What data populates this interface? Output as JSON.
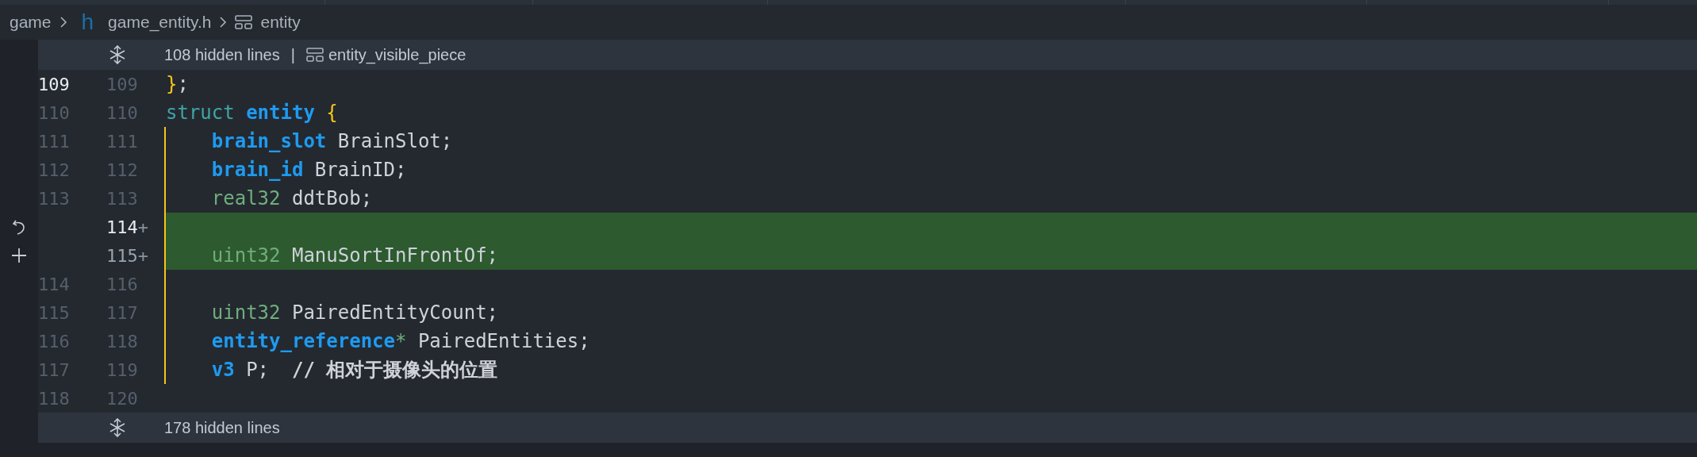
{
  "breadcrumb": {
    "items": [
      {
        "kind": "folder",
        "label": "game"
      },
      {
        "kind": "file",
        "icon_text": "h",
        "label": "game_entity.h"
      },
      {
        "kind": "symbol",
        "label": "entity"
      }
    ]
  },
  "folds": [
    {
      "label": "108 hidden lines",
      "separator": "|",
      "symbol": "entity_visible_piece"
    },
    {
      "label": "178 hidden lines"
    }
  ],
  "lines": [
    {
      "kind": "unchanged",
      "old": "109",
      "new": "109",
      "current": true,
      "guide": false,
      "tokens": [
        {
          "kind": "brace",
          "text": "}"
        },
        {
          "kind": "plain",
          "text": ";"
        }
      ]
    },
    {
      "kind": "unchanged",
      "old": "110",
      "new": "110",
      "current": false,
      "guide": false,
      "tokens": [
        {
          "kind": "keyword",
          "text": "struct "
        },
        {
          "kind": "type_bold",
          "text": "entity"
        },
        {
          "kind": "brace",
          "text": " {"
        }
      ]
    },
    {
      "kind": "unchanged",
      "old": "111",
      "new": "111",
      "current": false,
      "guide": true,
      "tokens": [
        {
          "kind": "type_bold",
          "text": "    brain_slot"
        },
        {
          "kind": "plain",
          "text": " BrainSlot;"
        }
      ]
    },
    {
      "kind": "unchanged",
      "old": "112",
      "new": "112",
      "current": false,
      "guide": true,
      "tokens": [
        {
          "kind": "type_bold",
          "text": "    brain_id"
        },
        {
          "kind": "plain",
          "text": " BrainID;"
        }
      ]
    },
    {
      "kind": "unchanged",
      "old": "113",
      "new": "113",
      "current": false,
      "guide": true,
      "tokens": [
        {
          "kind": "type",
          "text": "    real32"
        },
        {
          "kind": "plain",
          "text": " ddtBob;"
        }
      ]
    },
    {
      "kind": "added_revert",
      "new": "114",
      "current": true,
      "guide": true,
      "marker": "+"
    },
    {
      "kind": "added_stage",
      "new": "115",
      "current": false,
      "guide": true,
      "marker": "+",
      "tokens": [
        {
          "kind": "type",
          "text": "    uint32"
        },
        {
          "kind": "plain",
          "text": " ManuSortInFrontOf;"
        }
      ]
    },
    {
      "kind": "unchanged",
      "old": "114",
      "new": "116",
      "current": false,
      "guide": true
    },
    {
      "kind": "unchanged",
      "old": "115",
      "new": "117",
      "current": false,
      "guide": true,
      "tokens": [
        {
          "kind": "type",
          "text": "    uint32"
        },
        {
          "kind": "plain",
          "text": " PairedEntityCount;"
        }
      ]
    },
    {
      "kind": "unchanged",
      "old": "116",
      "new": "118",
      "current": false,
      "guide": true,
      "tokens": [
        {
          "kind": "type_bold",
          "text": "    entity_reference"
        },
        {
          "kind": "type",
          "text": "*"
        },
        {
          "kind": "plain",
          "text": " PairedEntities;"
        }
      ]
    },
    {
      "kind": "unchanged",
      "old": "117",
      "new": "119",
      "current": false,
      "guide": true,
      "tokens": [
        {
          "kind": "type_bold",
          "text": "    v3"
        },
        {
          "kind": "plain",
          "text": " P;  "
        },
        {
          "kind": "comment",
          "text": "// 相对于摄像头的位置"
        }
      ]
    },
    {
      "kind": "unchanged",
      "old": "118",
      "new": "120",
      "current": false,
      "guide": false
    }
  ]
}
